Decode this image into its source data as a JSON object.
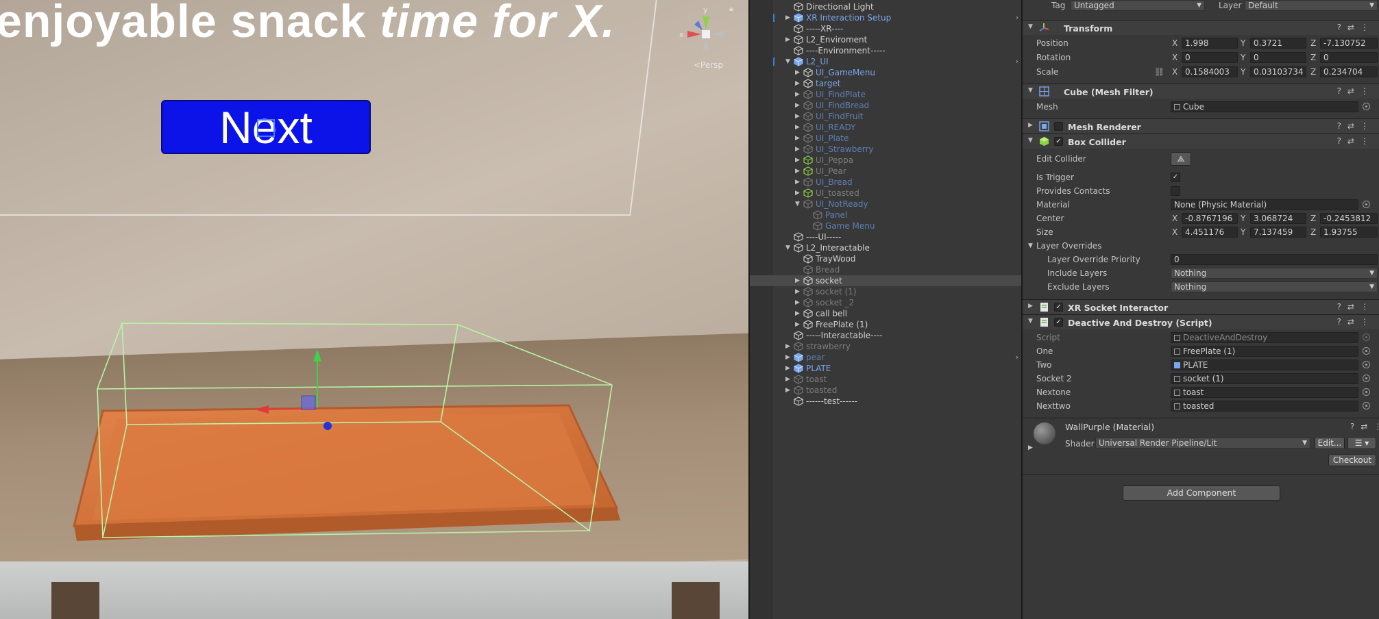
{
  "scene": {
    "headline_part1": "enjoyable snack ",
    "headline_part2": "time for X.",
    "next_button": "Next",
    "gizmo_y": "y",
    "gizmo_x": "x",
    "persp_label": "<Persp"
  },
  "hierarchy": {
    "rows": [
      {
        "label": "Directional Light",
        "color": "normal",
        "indent": 1,
        "arrow": "",
        "icon": "cube"
      },
      {
        "label": "XR Interaction Setup",
        "color": "blue",
        "indent": 1,
        "arrow": "▶",
        "icon": "prefab",
        "more": "›",
        "mark": true
      },
      {
        "label": "-----XR----",
        "color": "normal",
        "indent": 1,
        "arrow": "",
        "icon": "cube"
      },
      {
        "label": "L2_Enviroment",
        "color": "normal",
        "indent": 1,
        "arrow": "▶",
        "icon": "cube"
      },
      {
        "label": "----Environment-----",
        "color": "normal",
        "indent": 1,
        "arrow": "",
        "icon": "cube"
      },
      {
        "label": "L2_UI",
        "color": "blue",
        "indent": 1,
        "arrow": "▼",
        "icon": "prefab",
        "more": "›",
        "mark": true
      },
      {
        "label": "UI_GameMenu",
        "color": "blue",
        "indent": 2,
        "arrow": "▶",
        "icon": "cube"
      },
      {
        "label": "target",
        "color": "blue",
        "indent": 2,
        "arrow": "▶",
        "icon": "cube"
      },
      {
        "label": "UI_FindPlate",
        "color": "dimblue",
        "indent": 2,
        "arrow": "▶",
        "icon": "cube"
      },
      {
        "label": "UI_FindBread",
        "color": "dimblue",
        "indent": 2,
        "arrow": "▶",
        "icon": "cube"
      },
      {
        "label": "UI_FindFruit",
        "color": "dimblue",
        "indent": 2,
        "arrow": "▶",
        "icon": "cube"
      },
      {
        "label": "UI_READY",
        "color": "dimblue",
        "indent": 2,
        "arrow": "▶",
        "icon": "cube"
      },
      {
        "label": "UI_Plate",
        "color": "dimblue",
        "indent": 2,
        "arrow": "▶",
        "icon": "cube"
      },
      {
        "label": "UI_Strawberry",
        "color": "dimblue",
        "indent": 2,
        "arrow": "▶",
        "icon": "cube"
      },
      {
        "label": "UI_Peppa",
        "color": "dim",
        "indent": 2,
        "arrow": "▶",
        "icon": "cube-green"
      },
      {
        "label": "UI_Pear",
        "color": "dim",
        "indent": 2,
        "arrow": "▶",
        "icon": "cube-green"
      },
      {
        "label": "UI_Bread",
        "color": "dimblue",
        "indent": 2,
        "arrow": "▶",
        "icon": "cube"
      },
      {
        "label": "UI_toasted",
        "color": "dim",
        "indent": 2,
        "arrow": "▶",
        "icon": "cube-green"
      },
      {
        "label": "UI_NotReady",
        "color": "dimblue",
        "indent": 2,
        "arrow": "▼",
        "icon": "cube"
      },
      {
        "label": "Panel",
        "color": "dimblue",
        "indent": 3,
        "arrow": "",
        "icon": "cube"
      },
      {
        "label": "Game Menu",
        "color": "dimblue",
        "indent": 3,
        "arrow": "",
        "icon": "cube"
      },
      {
        "label": "----UI-----",
        "color": "normal",
        "indent": 1,
        "arrow": "",
        "icon": "cube"
      },
      {
        "label": "L2_Interactable",
        "color": "normal",
        "indent": 1,
        "arrow": "▼",
        "icon": "cube"
      },
      {
        "label": "TrayWood",
        "color": "normal",
        "indent": 2,
        "arrow": "",
        "icon": "cube"
      },
      {
        "label": "Bread",
        "color": "dim",
        "indent": 2,
        "arrow": "",
        "icon": "cube"
      },
      {
        "label": "socket",
        "color": "normal",
        "indent": 2,
        "arrow": "▶",
        "icon": "cube",
        "selected": true
      },
      {
        "label": "socket (1)",
        "color": "dim",
        "indent": 2,
        "arrow": "▶",
        "icon": "cube"
      },
      {
        "label": "socket _2",
        "color": "dim",
        "indent": 2,
        "arrow": "▶",
        "icon": "cube"
      },
      {
        "label": "call bell",
        "color": "normal",
        "indent": 2,
        "arrow": "▶",
        "icon": "cube"
      },
      {
        "label": "FreePlate (1)",
        "color": "normal",
        "indent": 2,
        "arrow": "▶",
        "icon": "cube"
      },
      {
        "label": "-----Interactable----",
        "color": "normal",
        "indent": 1,
        "arrow": "",
        "icon": "cube"
      },
      {
        "label": "strawberry",
        "color": "dim",
        "indent": 1,
        "arrow": "▶",
        "icon": "cube"
      },
      {
        "label": "pear",
        "color": "dimblue",
        "indent": 1,
        "arrow": "▶",
        "icon": "prefab",
        "more": "›"
      },
      {
        "label": "PLATE",
        "color": "blue",
        "indent": 1,
        "arrow": "▶",
        "icon": "prefab"
      },
      {
        "label": "toast",
        "color": "dim",
        "indent": 1,
        "arrow": "▶",
        "icon": "cube"
      },
      {
        "label": "toasted",
        "color": "dim",
        "indent": 1,
        "arrow": "▶",
        "icon": "cube"
      },
      {
        "label": "------test------",
        "color": "normal",
        "indent": 1,
        "arrow": "",
        "icon": "cube"
      }
    ]
  },
  "inspector": {
    "tag_label": "Tag",
    "tag_value": "Untagged",
    "layer_label": "Layer",
    "layer_value": "Default",
    "transform": {
      "title": "Transform",
      "position_label": "Position",
      "px": "1.998",
      "py": "0.3721",
      "pz": "-7.130752",
      "rotation_label": "Rotation",
      "rx": "0",
      "ry": "0",
      "rz": "0",
      "scale_label": "Scale",
      "sx": "0.1584003",
      "sy": "0.03103734",
      "sz": "0.234704"
    },
    "mesh_filter": {
      "title": "Cube (Mesh Filter)",
      "mesh_label": "Mesh",
      "mesh_value": "Cube"
    },
    "mesh_renderer": {
      "title": "Mesh Renderer"
    },
    "box_collider": {
      "title": "Box Collider",
      "edit_label": "Edit Collider",
      "trigger_label": "Is Trigger",
      "contacts_label": "Provides Contacts",
      "material_label": "Material",
      "material_value": "None (Physic Material)",
      "center_label": "Center",
      "cx": "-0.8767196",
      "cy": "3.068724",
      "cz": "-0.2453812",
      "size_label": "Size",
      "szx": "4.451176",
      "szy": "7.137459",
      "szz": "1.93755",
      "overrides_label": "Layer Overrides",
      "priority_label": "Layer Override Priority",
      "priority_value": "0",
      "include_label": "Include Layers",
      "include_value": "Nothing",
      "exclude_label": "Exclude Layers",
      "exclude_value": "Nothing"
    },
    "xr_socket": {
      "title": "XR Socket Interactor"
    },
    "deactive": {
      "title": "Deactive And Destroy (Script)",
      "script_label": "Script",
      "script_value": "DeactiveAndDestroy",
      "one_label": "One",
      "one_value": "FreePlate (1)",
      "two_label": "Two",
      "two_value": "PLATE",
      "socket2_label": "Socket 2",
      "socket2_value": "socket (1)",
      "nextone_label": "Nextone",
      "nextone_value": "toast",
      "nexttwo_label": "Nexttwo",
      "nexttwo_value": "toasted"
    },
    "material": {
      "title": "WallPurple (Material)",
      "shader_label": "Shader",
      "shader_value": "Universal Render Pipeline/Lit",
      "edit_button": "Edit...",
      "checkout_button": "Checkout"
    },
    "add_component": "Add Component",
    "axes": {
      "x": "X",
      "y": "Y",
      "z": "Z"
    }
  }
}
